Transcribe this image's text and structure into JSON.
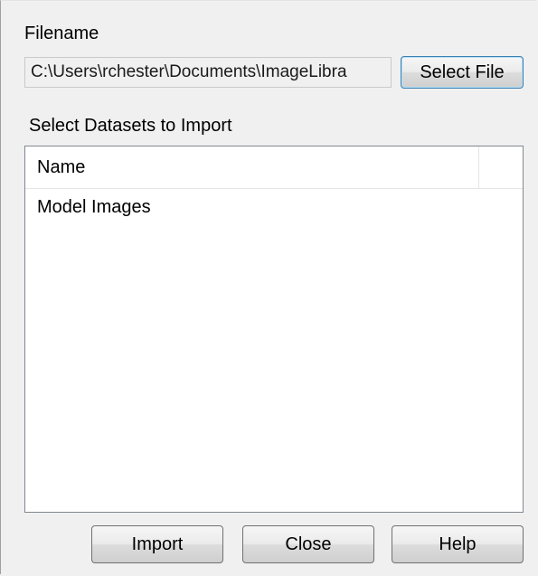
{
  "filename": {
    "label": "Filename",
    "path_value": "C:\\Users\\rchester\\Documents\\ImageLibra",
    "select_button": "Select File"
  },
  "datasets": {
    "label": "Select Datasets to Import",
    "columns": [
      "Name",
      ""
    ],
    "rows": [
      {
        "name": "Model Images"
      }
    ]
  },
  "buttons": {
    "import": "Import",
    "close": "Close",
    "help": "Help"
  }
}
